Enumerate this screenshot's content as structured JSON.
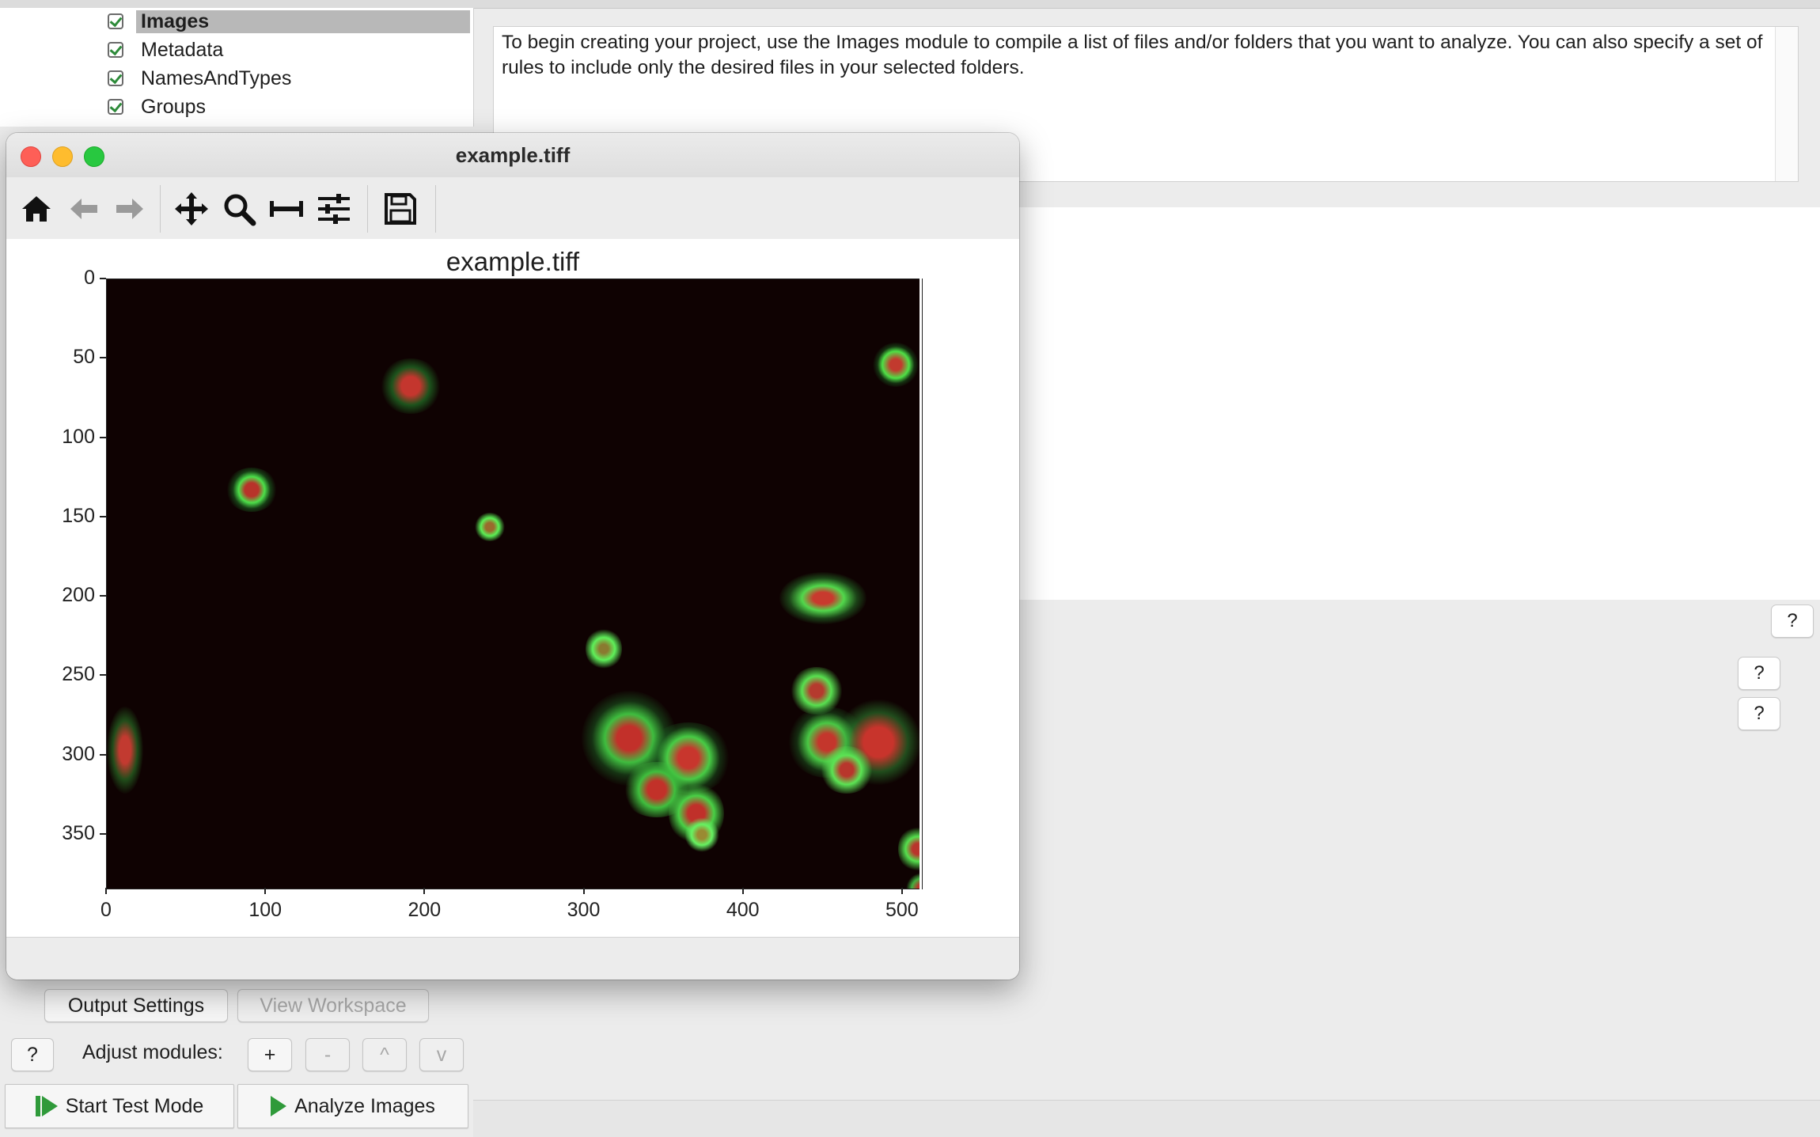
{
  "modules": [
    {
      "label": "Images",
      "selected": true
    },
    {
      "label": "Metadata",
      "selected": false
    },
    {
      "label": "NamesAndTypes",
      "selected": false
    },
    {
      "label": "Groups",
      "selected": false
    }
  ],
  "help_text": "To begin creating your project, use the Images module to compile a list of files and/or folders that you want to analyze. You can also specify a set of rules to include only the desired files in your selected folders.",
  "help_buttons": [
    "?",
    "?",
    "?"
  ],
  "figure_window": {
    "title": "example.tiff",
    "toolbar_icons": [
      "home-icon",
      "back-arrow-icon",
      "forward-arrow-icon",
      "pan-move-icon",
      "zoom-magnifier-icon",
      "subplots-adjust-icon",
      "configure-sliders-icon",
      "save-floppy-icon"
    ]
  },
  "chart_data": {
    "type": "image",
    "title": "example.tiff",
    "xlabel": "",
    "ylabel": "",
    "xlim": [
      0,
      512
    ],
    "ylim": [
      384,
      0
    ],
    "xticks": [
      "0",
      "100",
      "200",
      "300",
      "400",
      "500"
    ],
    "yticks": [
      "0",
      "50",
      "100",
      "150",
      "200",
      "250",
      "300",
      "350"
    ],
    "grid": false
  },
  "bottom": {
    "output_settings": "Output Settings",
    "view_workspace": "View Workspace",
    "help": "?",
    "adjust_label": "Adjust modules:",
    "add": "+",
    "remove": "-",
    "up": "^",
    "down": "v",
    "start_test": "Start Test Mode",
    "analyze": "Analyze Images"
  },
  "colors": {
    "accent_green": "#2f9a3a",
    "close": "#fe5f57",
    "minimize": "#febc2e",
    "zoom": "#28c840"
  }
}
